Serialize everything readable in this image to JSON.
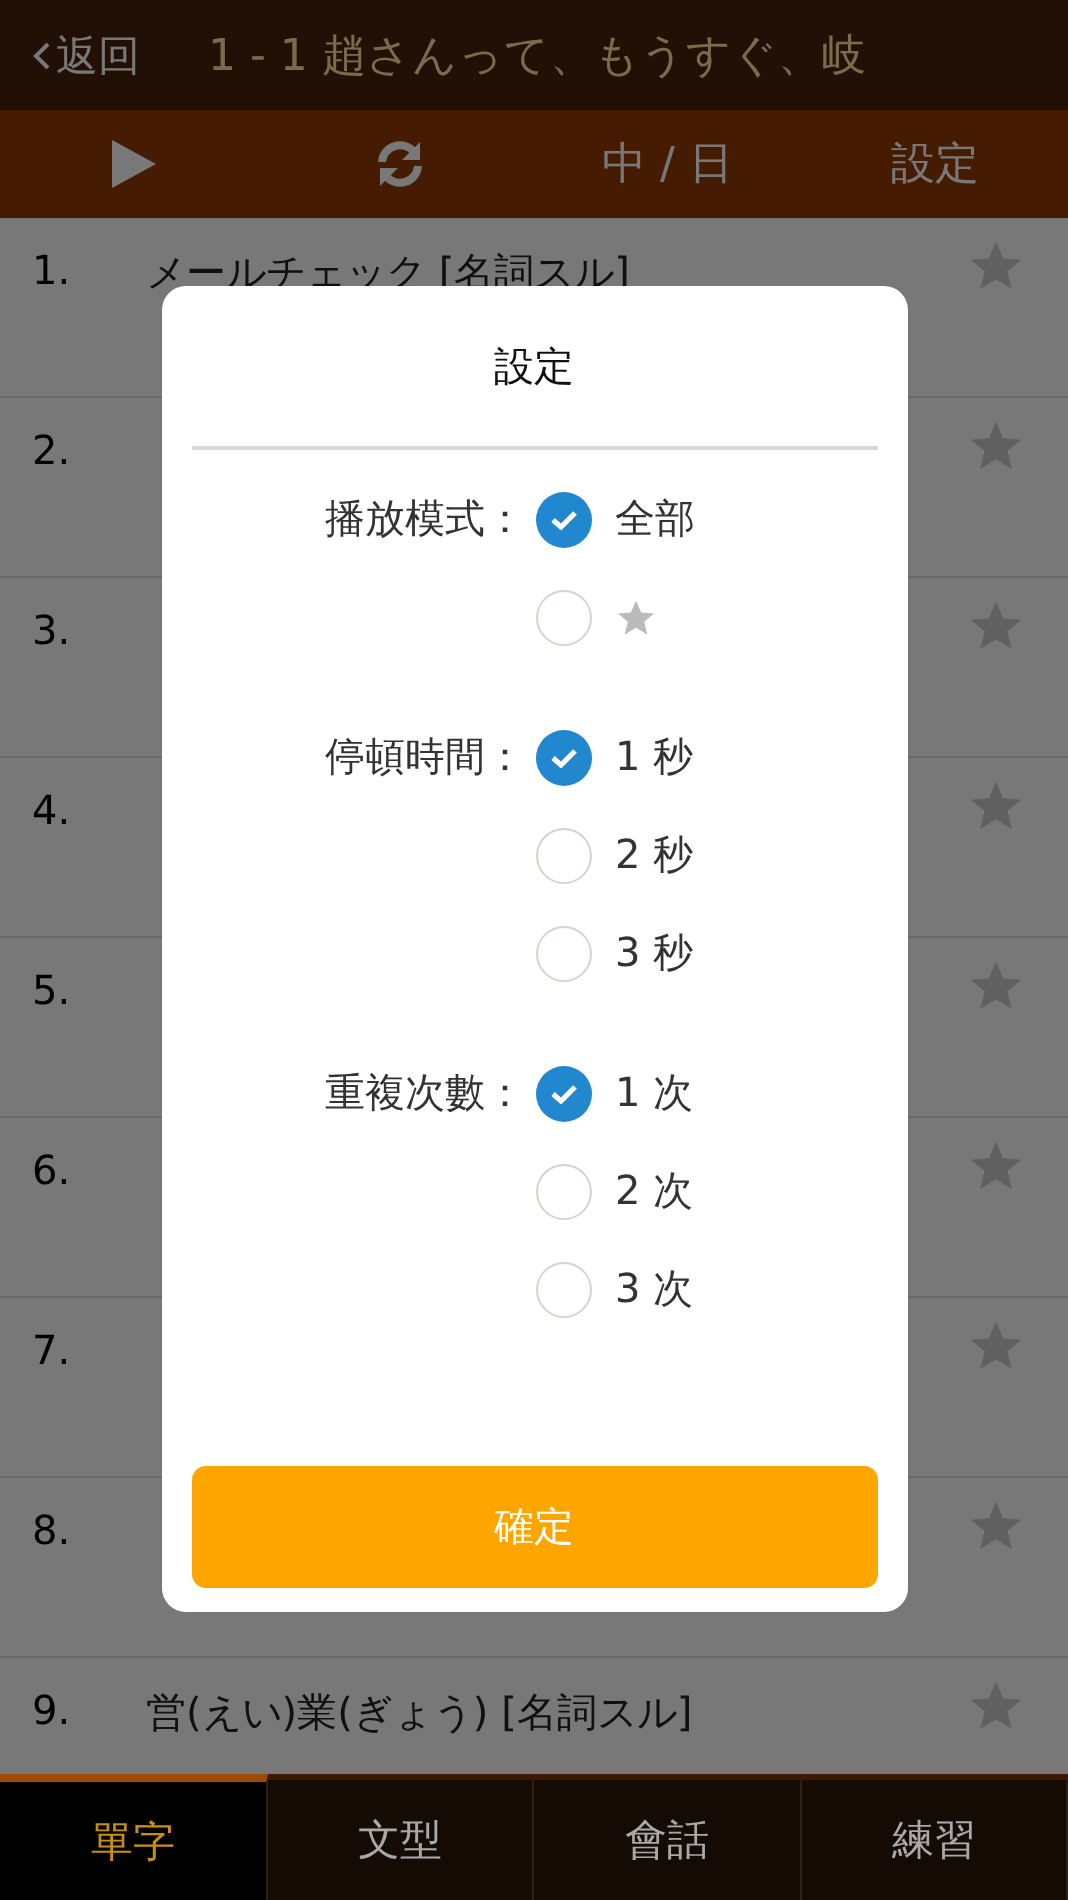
{
  "header": {
    "back": "返回",
    "title": "1 - 1 趙さんって、もうすぐ、岐"
  },
  "toolbar": {
    "language": "中 / 日",
    "settings": "設定"
  },
  "words": [
    {
      "number": "1.",
      "word": "メールチェック [名詞スル]"
    },
    {
      "number": "2."
    },
    {
      "number": "3."
    },
    {
      "number": "4."
    },
    {
      "number": "5."
    },
    {
      "number": "6."
    },
    {
      "number": "7."
    },
    {
      "number": "8."
    },
    {
      "number": "9.",
      "word": "営(えい)業(ぎょう)  [名詞スル]"
    }
  ],
  "dialog": {
    "title": "設定",
    "groups": [
      {
        "label": "播放模式：",
        "options": [
          {
            "kind": "text",
            "label": "全部",
            "selected": true
          },
          {
            "kind": "star",
            "selected": false
          }
        ]
      },
      {
        "label": "停頓時間：",
        "options": [
          {
            "kind": "text",
            "label": "1 秒",
            "selected": true
          },
          {
            "kind": "text",
            "label": "2 秒",
            "selected": false
          },
          {
            "kind": "text",
            "label": "3 秒",
            "selected": false
          }
        ]
      },
      {
        "label": "重複次數：",
        "options": [
          {
            "kind": "text",
            "label": "1 次",
            "selected": true
          },
          {
            "kind": "text",
            "label": "2 次",
            "selected": false
          },
          {
            "kind": "text",
            "label": "3 次",
            "selected": false
          }
        ]
      }
    ],
    "confirm": "確定"
  },
  "tabs": [
    {
      "label": "單字",
      "selected": true
    },
    {
      "label": "文型",
      "selected": false
    },
    {
      "label": "會話",
      "selected": false
    },
    {
      "label": "練習",
      "selected": false
    }
  ]
}
